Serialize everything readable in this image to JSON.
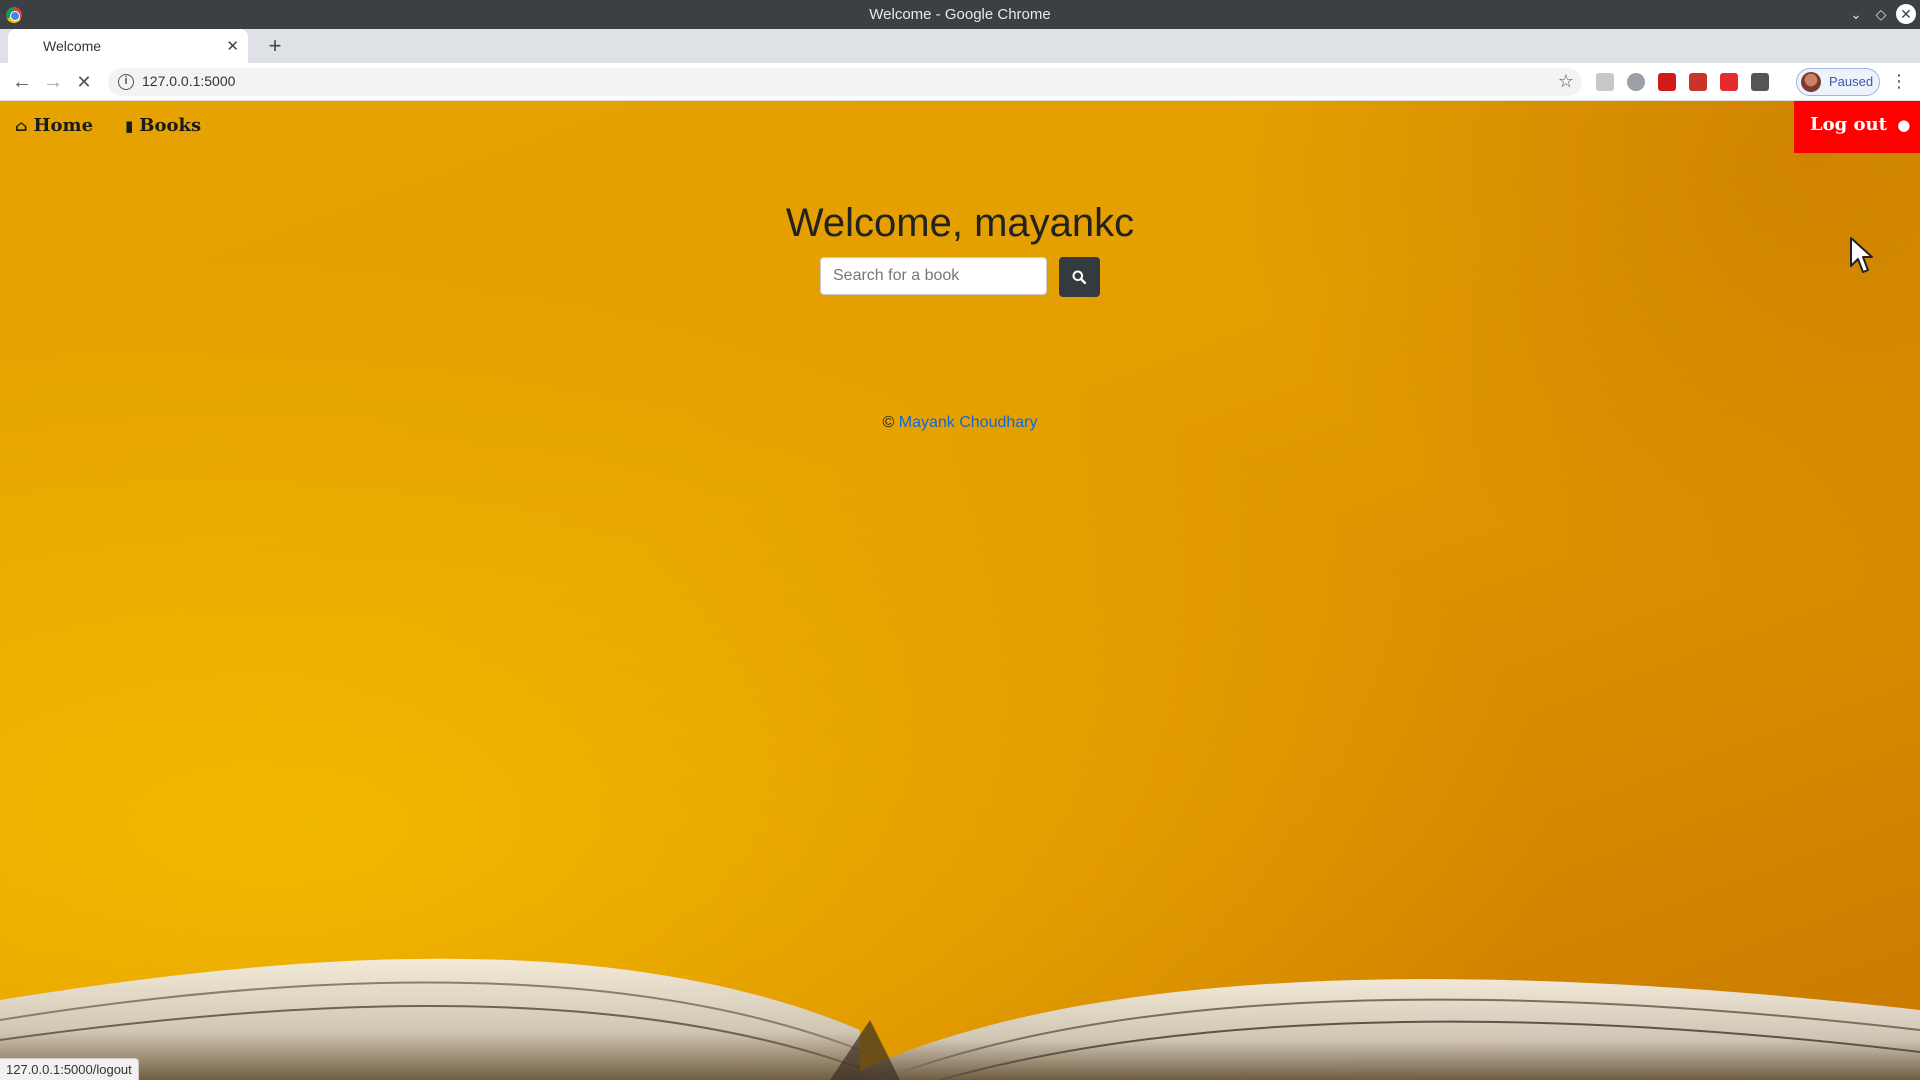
{
  "window": {
    "title": "Welcome - Google Chrome"
  },
  "tab": {
    "title": "Welcome"
  },
  "toolbar": {
    "url": "127.0.0.1:5000",
    "profile_label": "Paused"
  },
  "page": {
    "nav": {
      "home": "Home",
      "books": "Books",
      "logout": "Log out"
    },
    "welcome": "Welcome, mayankc",
    "search": {
      "placeholder": "Search for a book"
    },
    "footer": {
      "copyright": "©",
      "author": "Mayank Choudhary"
    }
  },
  "status_bar": {
    "url": "127.0.0.1:5000/logout"
  },
  "colors": {
    "background": "#e3a100",
    "logout_button": "#ff0000",
    "search_button": "#343a40",
    "link": "#1268d6"
  },
  "icons": [
    "chrome-logo-icon",
    "close-icon",
    "new-tab-icon",
    "back-icon",
    "forward-icon",
    "stop-icon",
    "info-icon",
    "star-icon",
    "home-icon",
    "book-icon",
    "user-icon",
    "search-icon",
    "cursor-icon"
  ]
}
